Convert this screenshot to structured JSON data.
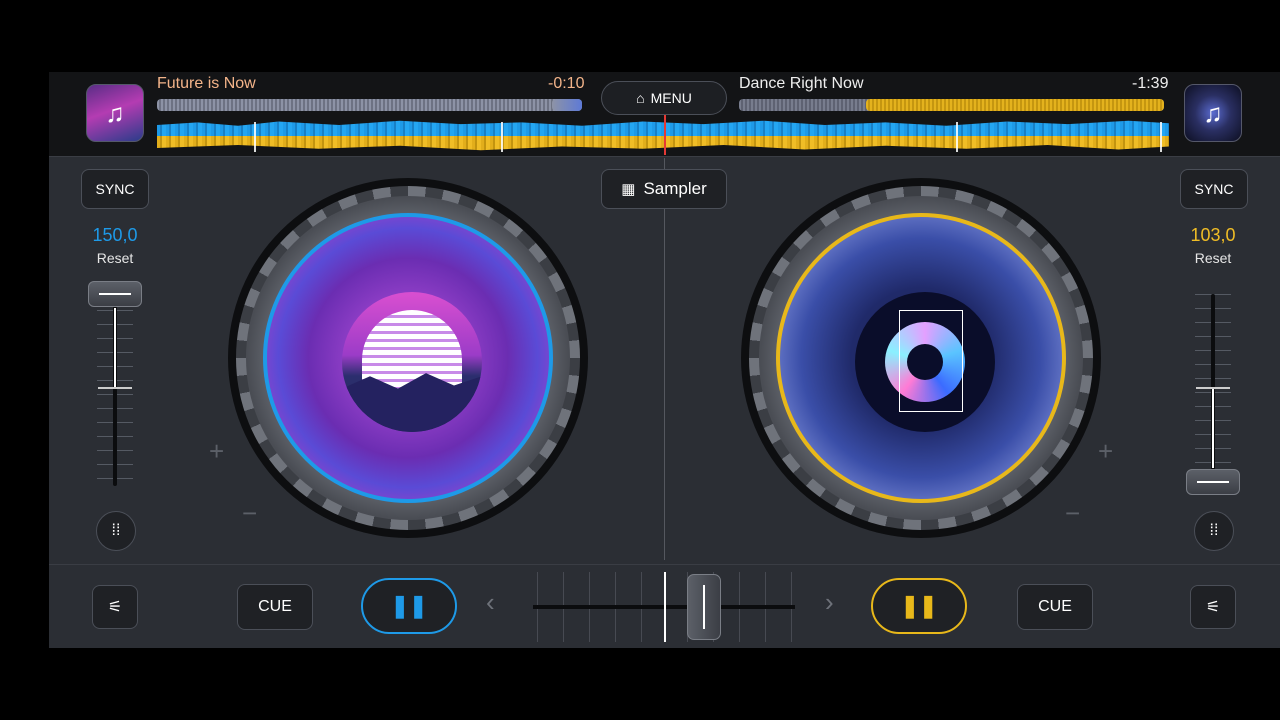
{
  "top_bar": {
    "menu_label": "MENU",
    "left_deck": {
      "title": "Future is Now",
      "remaining": "-0:10"
    },
    "right_deck": {
      "title": "Dance Right Now",
      "remaining": "-1:39"
    }
  },
  "decks": {
    "left": {
      "sync_label": "SYNC",
      "bpm": "150,0",
      "reset_label": "Reset",
      "cue_label": "CUE",
      "play_glyph": "❚❚",
      "accent": "#1e9ae8"
    },
    "right": {
      "sync_label": "SYNC",
      "bpm": "103,0",
      "reset_label": "Reset",
      "cue_label": "CUE",
      "play_glyph": "❚❚",
      "accent": "#e8b81a"
    }
  },
  "center": {
    "sampler_label": "Sampler"
  },
  "icons": {
    "note": "♫",
    "home": "⌂",
    "grid": "▦",
    "eq": "⁞⁞",
    "mixer": "⚟",
    "prev": "‹",
    "next": "›",
    "plus": "+",
    "minus": "−"
  }
}
